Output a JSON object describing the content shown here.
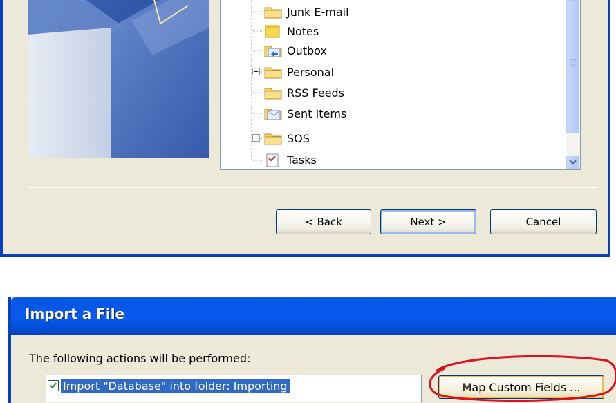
{
  "top_dialog": {
    "folder_tree": {
      "items": [
        {
          "label": "Junk E-mail",
          "icon": "folder-icon",
          "expandable": false
        },
        {
          "label": "Notes",
          "icon": "notes-folder-icon",
          "expandable": false
        },
        {
          "label": "Outbox",
          "icon": "outbox-folder-icon",
          "expandable": false
        },
        {
          "label": "Personal",
          "icon": "folder-icon",
          "expandable": true,
          "expander": "+"
        },
        {
          "label": "RSS Feeds",
          "icon": "folder-icon",
          "expandable": false
        },
        {
          "label": "Sent Items",
          "icon": "sent-items-folder-icon",
          "expandable": false
        },
        {
          "label": "SOS",
          "icon": "folder-icon",
          "expandable": true,
          "expander": "+"
        },
        {
          "label": "Tasks",
          "icon": "tasks-folder-icon",
          "expandable": false
        }
      ]
    },
    "buttons": {
      "back": "< Back",
      "next": "Next >",
      "cancel": "Cancel"
    }
  },
  "bottom_dialog": {
    "title": "Import a File",
    "actions_heading": "The following actions will be performed:",
    "action_item": {
      "label": "Import \"Database\" into folder: Importing",
      "checked": true
    },
    "map_custom_fields_label": "Map Custom Fields ...",
    "annotation": "red-circle-highlight"
  },
  "colors": {
    "window_border": "#0a3fc0",
    "dialog_face": "#ece9d8",
    "selection": "#316ac5",
    "highlight_circle": "#e0101a"
  }
}
